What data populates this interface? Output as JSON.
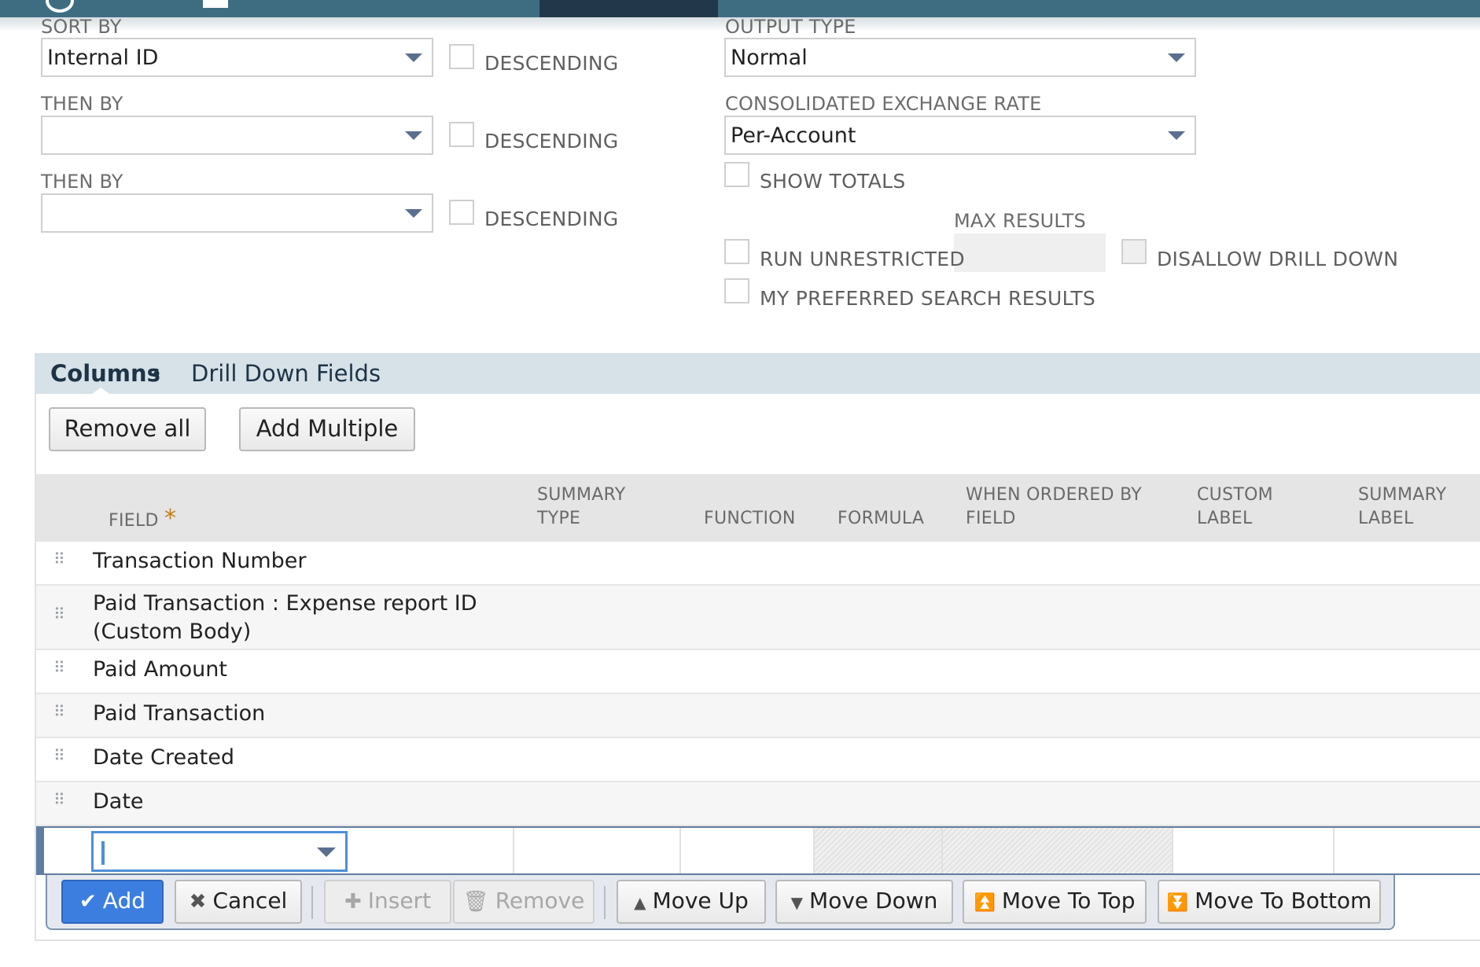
{
  "sort": {
    "sort_by_label": "SORT BY",
    "sort_by_value": "Internal ID",
    "then_by_label_1": "THEN BY",
    "then_by_value_1": "",
    "then_by_label_2": "THEN BY",
    "then_by_value_2": "",
    "descending_label": "DESCENDING"
  },
  "output": {
    "output_type_label": "OUTPUT TYPE",
    "output_type_value": "Normal",
    "exchange_rate_label": "CONSOLIDATED EXCHANGE RATE",
    "exchange_rate_value": "Per-Account",
    "show_totals_label": "SHOW TOTALS",
    "max_results_label": "MAX RESULTS",
    "run_unrestricted_label": "RUN UNRESTRICTED",
    "disallow_drill_down_label": "DISALLOW DRILL DOWN",
    "preferred_results_label": "MY PREFERRED SEARCH RESULTS"
  },
  "tabs": {
    "active_label": "Columns",
    "active_dot": "•",
    "other_label": "Drill Down Fields"
  },
  "toolbar": {
    "remove_all_label": "Remove all",
    "add_multiple_label": "Add Multiple"
  },
  "table": {
    "headers": {
      "field": "FIELD",
      "field_required": "*",
      "summary_type_1": "SUMMARY",
      "summary_type_2": "TYPE",
      "function": "FUNCTION",
      "formula": "FORMULA",
      "when_ordered_1": "WHEN ORDERED BY",
      "when_ordered_2": "FIELD",
      "custom_label_1": "CUSTOM",
      "custom_label_2": "LABEL",
      "summary_label_1": "SUMMARY",
      "summary_label_2": "LABEL"
    },
    "rows": [
      {
        "field": "Transaction Number"
      },
      {
        "field_line1": "Paid Transaction : Expense report ID",
        "field_line2": "(Custom Body)"
      },
      {
        "field": "Paid Amount"
      },
      {
        "field": "Paid Transaction"
      },
      {
        "field": "Date Created"
      },
      {
        "field": "Date"
      }
    ]
  },
  "actions": {
    "add": "Add",
    "cancel": "Cancel",
    "insert": "Insert",
    "remove": "Remove",
    "move_up": "Move Up",
    "move_down": "Move Down",
    "move_to_top": "Move To Top",
    "move_to_bottom": "Move To Bottom"
  },
  "icons": {
    "add": "check-icon",
    "cancel": "x-icon",
    "insert": "plus-icon",
    "remove": "trash-icon",
    "move_up": "arrow-up-icon",
    "move_down": "arrow-down-icon",
    "move_to_top": "arrow-to-top-icon",
    "move_to_bottom": "arrow-to-bottom-icon"
  },
  "colors": {
    "header_bar": "#3e6d82",
    "tab_bar": "#d6e2e8",
    "primary_button": "#3c7ee0"
  }
}
